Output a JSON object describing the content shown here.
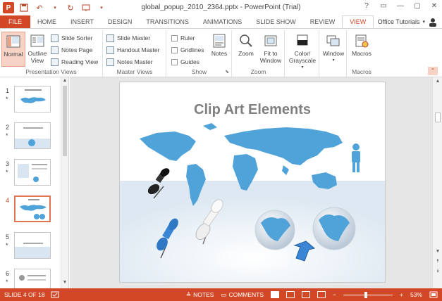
{
  "window": {
    "title": "global_popup_2010_2364.pptx - PowerPoint (Trial)",
    "controls": [
      "?",
      "▭",
      "—",
      "▢",
      "✕"
    ]
  },
  "tabs": [
    "FILE",
    "HOME",
    "INSERT",
    "DESIGN",
    "TRANSITIONS",
    "ANIMATIONS",
    "SLIDE SHOW",
    "REVIEW",
    "VIEW"
  ],
  "active_tab": "VIEW",
  "account": {
    "name": "Office Tutorials"
  },
  "ribbon": {
    "presentation_views": {
      "label": "Presentation Views",
      "normal": "Normal",
      "outline_view": "Outline View",
      "slide_sorter": "Slide Sorter",
      "notes_page": "Notes Page",
      "reading_view": "Reading View"
    },
    "master_views": {
      "label": "Master Views",
      "slide_master": "Slide Master",
      "handout_master": "Handout Master",
      "notes_master": "Notes Master"
    },
    "show": {
      "label": "Show",
      "ruler": "Ruler",
      "gridlines": "Gridlines",
      "guides": "Guides",
      "notes": "Notes"
    },
    "zoom": {
      "label": "Zoom",
      "zoom": "Zoom",
      "fit_to_window": "Fit to Window"
    },
    "color": {
      "label": "Color/ Grayscale"
    },
    "window": {
      "label": "Window"
    },
    "macros": {
      "label": "Macros",
      "macros": "Macros"
    }
  },
  "thumbnails": [
    {
      "num": "1",
      "star": "*"
    },
    {
      "num": "2",
      "star": "*"
    },
    {
      "num": "3",
      "star": "*"
    },
    {
      "num": "4",
      "star": ""
    },
    {
      "num": "5",
      "star": "*"
    },
    {
      "num": "6",
      "star": "*"
    }
  ],
  "slide": {
    "title": "Clip Art Elements"
  },
  "statusbar": {
    "slide_info": "SLIDE 4 OF 18",
    "notes": "NOTES",
    "comments": "COMMENTS",
    "zoom_level": "53%"
  },
  "colors": {
    "accent": "#d24726",
    "map": "#4fa3d9"
  }
}
